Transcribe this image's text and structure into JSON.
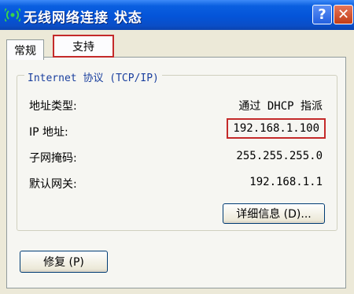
{
  "window": {
    "title": "无线网络连接 状态",
    "help_label": "?",
    "close_label": "✕"
  },
  "tabs": [
    {
      "label": "常规"
    },
    {
      "label": "支持"
    }
  ],
  "group": {
    "legend": "Internet 协议 (TCP/IP)",
    "rows": [
      {
        "label": "地址类型:",
        "value": "通过 DHCP 指派"
      },
      {
        "label": "IP 地址:",
        "value": "192.168.1.100"
      },
      {
        "label": "子网掩码:",
        "value": "255.255.255.0"
      },
      {
        "label": "默认网关:",
        "value": "192.168.1.1"
      }
    ],
    "details_button": "详细信息 (D)..."
  },
  "repair_button": "修复 (P)",
  "colors": {
    "titlebar": "#0454d8",
    "highlight": "#c42a2a",
    "background": "#ece9d8"
  },
  "icons": {
    "title_icon": "wireless-network-icon"
  }
}
